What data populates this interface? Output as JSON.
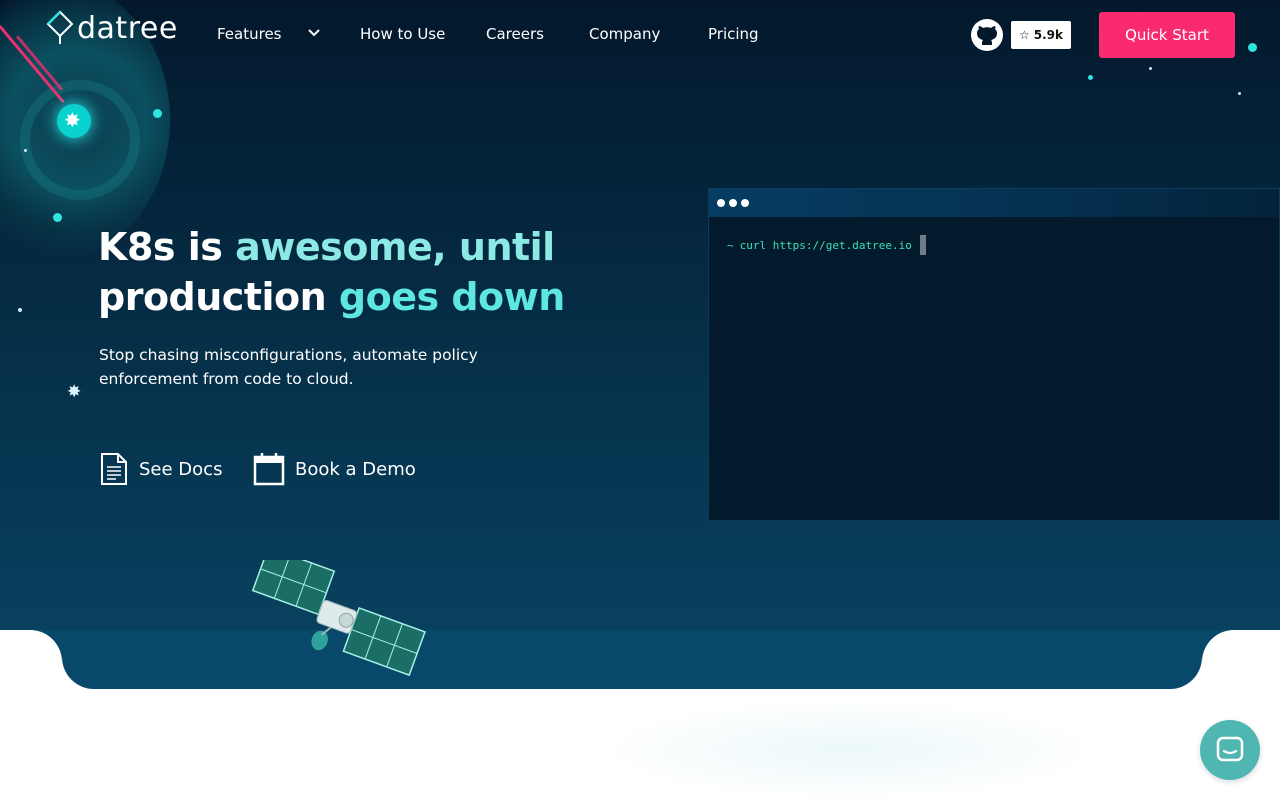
{
  "brand": {
    "name": "datree"
  },
  "nav": {
    "items": [
      {
        "label": "Features",
        "has_dropdown": true
      },
      {
        "label": "How to Use"
      },
      {
        "label": "Careers"
      },
      {
        "label": "Company"
      },
      {
        "label": "Pricing"
      }
    ],
    "github_stars": "5.9k",
    "quick_start_label": "Quick Start"
  },
  "hero": {
    "headline_part1": "K8s is ",
    "headline_part2": "awesome, until",
    "headline_part3": "production",
    "headline_part4": " goes down",
    "subtext": "Stop chasing misconfigurations, automate policy enforcement from code to cloud.",
    "cta_docs": "See Docs",
    "cta_demo": "Book a Demo"
  },
  "terminal": {
    "prompt": "~",
    "command": "curl https://get.datree.io"
  },
  "colors": {
    "accent_pink": "#fa2a70",
    "teal": "#5ee6e0",
    "hero_bg_top": "#03182c",
    "hero_bg_bottom": "#084564",
    "chat_bg": "#4fb6b2"
  },
  "icons": [
    "kubernetes-icon",
    "github-icon",
    "star-icon",
    "chevron-down-icon",
    "document-icon",
    "calendar-icon",
    "chat-icon",
    "satellite-illustration"
  ]
}
